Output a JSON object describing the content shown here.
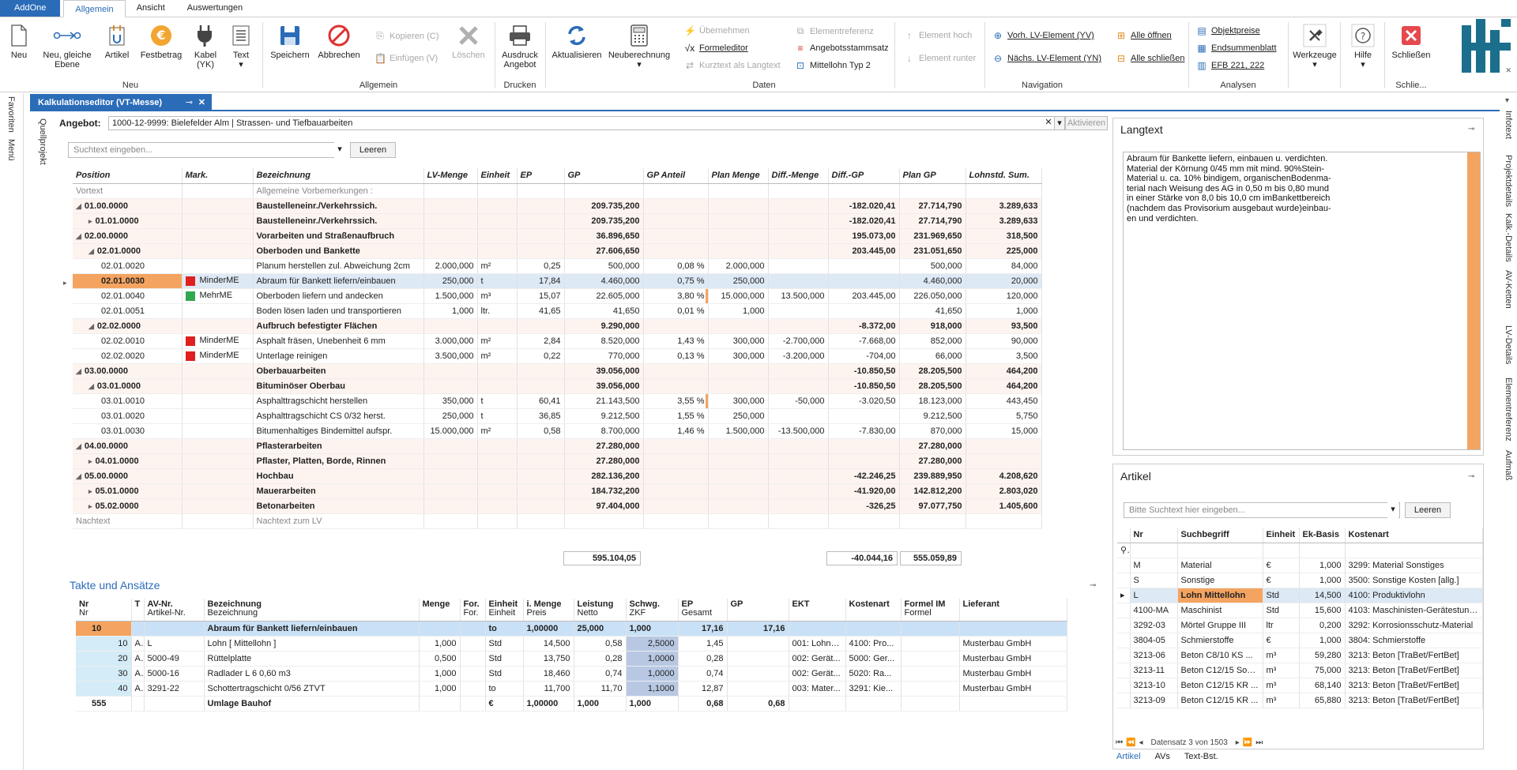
{
  "app_tabs": {
    "addone": "AddOne",
    "items": [
      "Allgemein",
      "Ansicht",
      "Auswertungen"
    ]
  },
  "ribbon": {
    "neu": "Neu",
    "neu_gleiche": "Neu, gleiche",
    "ebene": "Ebene",
    "artikel": "Artikel",
    "festbetrag": "Festbetrag",
    "kabel": "Kabel",
    "yk": "(YK)",
    "text": "Text",
    "neu_group": "Neu",
    "speichern": "Speichern",
    "abbrechen": "Abbrechen",
    "kopieren": "Kopieren (C)",
    "einfuegen": "Einfügen (V)",
    "loeschen": "Löschen",
    "allgemein_group": "Allgemein",
    "ausdruck": "Ausdruck",
    "angebot": "Angebot",
    "drucken_group": "Drucken",
    "aktualisieren": "Aktualisieren",
    "neuberechnung": "Neuberechnung",
    "uebernehmen": "Übernehmen",
    "formeleditor": "Formeleditor",
    "kurztext": "Kurztext als Langtext",
    "elementreferenz": "Elementreferenz",
    "angebotsstammsatz": "Angebotsstammsatz",
    "mittellohn": "Mittellohn Typ 2",
    "daten_group": "Daten",
    "element_hoch": "Element hoch",
    "element_runter": "Element runter",
    "vorh": "Vorh. LV-Element (YV)",
    "naechs": "Nächs. LV-Element (YN)",
    "alle_oeffnen": "Alle öffnen",
    "alle_schliessen": "Alle schließen",
    "navigation_group": "Navigation",
    "objektpreise": "Objektpreise",
    "endsummenblatt": "Endsummenblatt",
    "efb": "EFB 221, 222",
    "analysen_group": "Analysen",
    "werkzeuge": "Werkzeuge",
    "hilfe": "Hilfe",
    "schliessen": "Schließen",
    "schlie_group": "Schlie..."
  },
  "left_rail": [
    "Favoriten",
    "Menü"
  ],
  "right_rail": [
    "Infotext",
    "Projektdetails",
    "Kalk.-Details",
    "AV-Ketten",
    "LV-Details",
    "Elementreferenz",
    "Aufmaß"
  ],
  "doc_tab": "Kalkulationseditor (VT-Messe)",
  "quellprojekt": "Quellprojekt",
  "angebot": {
    "label": "Angebot:",
    "value": "1000-12-9999: Bielefelder Alm | Strassen- und Tiefbauarbeiten",
    "aktivieren": "Aktivieren"
  },
  "search": {
    "placeholder": "Suchtext eingeben...",
    "button": "Leeren"
  },
  "lv": {
    "headers": [
      "Position",
      "Mark.",
      "Bezeichnung",
      "LV-Menge",
      "Einheit",
      "EP",
      "GP",
      "GP Anteil",
      "Plan Menge",
      "Diff.-Menge",
      "Diff.-GP",
      "Plan GP",
      "Lohnstd. Sum."
    ],
    "rows": [
      {
        "ind": 0,
        "pos": "Vortext",
        "mark": "",
        "bez": "Allgemeine Vorbemerkungen :",
        "lvm": "",
        "ein": "",
        "ep": "",
        "gp": "",
        "ant": "",
        "pm": "",
        "dm": "",
        "dgp": "",
        "pgp": "",
        "ls": "",
        "cls": "dim"
      },
      {
        "ind": 0,
        "tri": "◢",
        "pos": "01.00.0000",
        "bez": "Baustelleneinr./Verkehrssich.",
        "gp": "209.735,200",
        "dgp": "-182.020,41",
        "pgp": "27.714,790",
        "ls": "3.289,633",
        "cls": "b lvl1"
      },
      {
        "ind": 1,
        "tri": "▸",
        "pos": "01.01.0000",
        "bez": "Baustelleneinr./Verkehrssich.",
        "gp": "209.735,200",
        "dgp": "-182.020,41",
        "pgp": "27.714,790",
        "ls": "3.289,633",
        "cls": "b lvl1"
      },
      {
        "ind": 0,
        "tri": "◢",
        "pos": "02.00.0000",
        "bez": "Vorarbeiten und Straßenaufbruch",
        "gp": "36.896,650",
        "dgp": "195.073,00",
        "pgp": "231.969,650",
        "ls": "318,500",
        "cls": "b lvl1"
      },
      {
        "ind": 1,
        "tri": "◢",
        "pos": "02.01.0000",
        "bez": "Oberboden und Bankette",
        "gp": "27.606,650",
        "dgp": "203.445,00",
        "pgp": "231.051,650",
        "ls": "225,000",
        "cls": "b lvl1"
      },
      {
        "ind": 2,
        "pos": "02.01.0020",
        "bez": "Planum herstellen zul. Abweichung 2cm",
        "lvm": "2.000,000",
        "ein": "m²",
        "ep": "0,25",
        "gp": "500,000",
        "ant": "0,08 %",
        "pm": "2.000,000",
        "pgp": "500,000",
        "ls": "84,000"
      },
      {
        "ind": 2,
        "pos": "02.01.0030",
        "mark": "red",
        "markt": "MinderME",
        "bez": "Abraum für Bankett liefern/einbauen",
        "lvm": "250,000",
        "ein": "t",
        "ep": "17,84",
        "gp": "4.460,000",
        "ant": "0,75 %",
        "pm": "250,000",
        "pgp": "4.460,000",
        "ls": "20,000",
        "cls": "sel",
        "hl": true
      },
      {
        "ind": 2,
        "pos": "02.01.0040",
        "mark": "green",
        "markt": "MehrME",
        "bez": "Oberboden liefern und andecken",
        "lvm": "1.500,000",
        "ein": "m³",
        "ep": "15,07",
        "gp": "22.605,000",
        "ant": "3,80 %",
        "pm": "15.000,000",
        "dm": "13.500,000",
        "dgp": "203.445,00",
        "pgp": "226.050,000",
        "ls": "120,000",
        "bar": true
      },
      {
        "ind": 2,
        "pos": "02.01.0051",
        "bez": "Boden lösen laden und transportieren",
        "lvm": "1,000",
        "ein": "ltr.",
        "ep": "41,65",
        "gp": "41,650",
        "ant": "0,01 %",
        "pm": "1,000",
        "pgp": "41,650",
        "ls": "1,000"
      },
      {
        "ind": 1,
        "tri": "◢",
        "pos": "02.02.0000",
        "bez": "Aufbruch befestigter Flächen",
        "gp": "9.290,000",
        "dgp": "-8.372,00",
        "pgp": "918,000",
        "ls": "93,500",
        "cls": "b lvl1"
      },
      {
        "ind": 2,
        "pos": "02.02.0010",
        "mark": "red",
        "markt": "MinderME",
        "bez": "Asphalt fräsen,  Unebenheit 6 mm",
        "lvm": "3.000,000",
        "ein": "m²",
        "ep": "2,84",
        "gp": "8.520,000",
        "ant": "1,43 %",
        "pm": "300,000",
        "dm": "-2.700,000",
        "dgp": "-7.668,00",
        "pgp": "852,000",
        "ls": "90,000"
      },
      {
        "ind": 2,
        "pos": "02.02.0020",
        "mark": "red",
        "markt": "MinderME",
        "bez": "Unterlage reinigen",
        "lvm": "3.500,000",
        "ein": "m²",
        "ep": "0,22",
        "gp": "770,000",
        "ant": "0,13 %",
        "pm": "300,000",
        "dm": "-3.200,000",
        "dgp": "-704,00",
        "pgp": "66,000",
        "ls": "3,500"
      },
      {
        "ind": 0,
        "tri": "◢",
        "pos": "03.00.0000",
        "bez": "Oberbauarbeiten",
        "gp": "39.056,000",
        "dgp": "-10.850,50",
        "pgp": "28.205,500",
        "ls": "464,200",
        "cls": "b lvl1"
      },
      {
        "ind": 1,
        "tri": "◢",
        "pos": "03.01.0000",
        "bez": "Bituminöser Oberbau",
        "gp": "39.056,000",
        "dgp": "-10.850,50",
        "pgp": "28.205,500",
        "ls": "464,200",
        "cls": "b lvl1"
      },
      {
        "ind": 2,
        "pos": "03.01.0010",
        "bez": "Asphalttragschicht herstellen",
        "lvm": "350,000",
        "ein": "t",
        "ep": "60,41",
        "gp": "21.143,500",
        "ant": "3,55 %",
        "pm": "300,000",
        "dm": "-50,000",
        "dgp": "-3.020,50",
        "pgp": "18.123,000",
        "ls": "443,450",
        "bar": true
      },
      {
        "ind": 2,
        "pos": "03.01.0020",
        "bez": "Asphalttragschicht CS 0/32 herst.",
        "lvm": "250,000",
        "ein": "t",
        "ep": "36,85",
        "gp": "9.212,500",
        "ant": "1,55 %",
        "pm": "250,000",
        "pgp": "9.212,500",
        "ls": "5,750"
      },
      {
        "ind": 2,
        "pos": "03.01.0030",
        "bez": "Bitumenhaltiges Bindemittel aufspr.",
        "lvm": "15.000,000",
        "ein": "m²",
        "ep": "0,58",
        "gp": "8.700,000",
        "ant": "1,46 %",
        "pm": "1.500,000",
        "dm": "-13.500,000",
        "dgp": "-7.830,00",
        "pgp": "870,000",
        "ls": "15,000"
      },
      {
        "ind": 0,
        "tri": "◢",
        "pos": "04.00.0000",
        "bez": "Pflasterarbeiten",
        "gp": "27.280,000",
        "pgp": "27.280,000",
        "cls": "b lvl1"
      },
      {
        "ind": 1,
        "tri": "▸",
        "pos": "04.01.0000",
        "bez": "Pflaster, Platten, Borde, Rinnen",
        "gp": "27.280,000",
        "pgp": "27.280,000",
        "cls": "b lvl1"
      },
      {
        "ind": 0,
        "tri": "◢",
        "pos": "05.00.0000",
        "bez": "Hochbau",
        "gp": "282.136,200",
        "dgp": "-42.246,25",
        "pgp": "239.889,950",
        "ls": "4.208,620",
        "cls": "b lvl1"
      },
      {
        "ind": 1,
        "tri": "▸",
        "pos": "05.01.0000",
        "bez": "Mauerarbeiten",
        "gp": "184.732,200",
        "dgp": "-41.920,00",
        "pgp": "142.812,200",
        "ls": "2.803,020",
        "cls": "b lvl1"
      },
      {
        "ind": 1,
        "tri": "▸",
        "pos": "05.02.0000",
        "bez": "Betonarbeiten",
        "gp": "97.404,000",
        "dgp": "-326,25",
        "pgp": "97.077,750",
        "ls": "1.405,600",
        "cls": "b lvl1"
      },
      {
        "ind": 0,
        "pos": "Nachtext",
        "bez": "Nachtext zum LV",
        "cls": "dim"
      }
    ],
    "totals": {
      "gp": "595.104,05",
      "dgp": "-40.044,16",
      "pgp": "555.059,89"
    }
  },
  "takte": {
    "title": "Takte und Ansätze",
    "headers1": [
      "Nr",
      "T",
      "AV-Nr.",
      "Bezeichnung",
      "Menge",
      "For.",
      "Einheit",
      "i. Menge",
      "Leistung",
      "Schwg.",
      "EP",
      "GP",
      "EKT",
      "Kostenart",
      "Formel IM",
      "Lieferant"
    ],
    "headers2": [
      "Nr",
      "",
      "Artikel-Nr.",
      "Bezeichnung",
      "",
      "For.",
      "Einheit",
      "Preis",
      "Netto",
      "ZKF",
      "Gesamt",
      "",
      "",
      "",
      "Formel",
      ""
    ],
    "rows": [
      {
        "nr": "10",
        "t": "",
        "av": "",
        "bez": "Abraum für Bankett liefern/einbauen",
        "menge": "",
        "for": "",
        "ein": "to",
        "im": "1,00000",
        "leist": "25,000",
        "schwg": "1,000",
        "ep": "17,16",
        "gp": "17,16",
        "ekt": "",
        "ka": "",
        "fim": "",
        "lief": "",
        "top": true
      },
      {
        "nr": "10",
        "t": "A",
        "av": "L",
        "bez": "Lohn [ Mittellohn ]",
        "menge": "1,000",
        "for": "",
        "ein": "Std",
        "im": "14,500",
        "leist": "0,58",
        "schwg": "2,5000",
        "ep": "1,45",
        "gp": "",
        "ekt": "001: Lohnk...",
        "ka": "4100: Pro...",
        "fim": "",
        "lief": "Musterbau GmbH"
      },
      {
        "nr": "20",
        "t": "A",
        "av": "5000-49",
        "bez": "Rüttelplatte",
        "menge": "0,500",
        "for": "",
        "ein": "Std",
        "im": "13,750",
        "leist": "0,28",
        "schwg": "1,0000",
        "ep": "0,28",
        "gp": "",
        "ekt": "002: Gerät...",
        "ka": "5000: Ger...",
        "fim": "",
        "lief": "Musterbau GmbH",
        "exp": true
      },
      {
        "nr": "30",
        "t": "A",
        "av": "5000-16",
        "bez": "Radlader L 6    0,60 m3",
        "menge": "1,000",
        "for": "",
        "ein": "Std",
        "im": "18,460",
        "leist": "0,74",
        "schwg": "1,0000",
        "ep": "0,74",
        "gp": "",
        "ekt": "002: Gerät...",
        "ka": "5020: Ra...",
        "fim": "",
        "lief": "Musterbau GmbH",
        "exp": true
      },
      {
        "nr": "40",
        "t": "A",
        "av": "3291-22",
        "bez": "Schottertragschicht  0/56 ZTVT",
        "menge": "1,000",
        "for": "",
        "ein": "to",
        "im": "11,700",
        "leist": "11,70",
        "schwg": "1,1000",
        "ep": "12,87",
        "gp": "",
        "ekt": "003: Mater...",
        "ka": "3291: Kie...",
        "fim": "",
        "lief": "Musterbau GmbH"
      },
      {
        "nr": "555",
        "t": "",
        "av": "",
        "bez": "Umlage Bauhof",
        "menge": "",
        "for": "",
        "ein": "€",
        "im": "1,00000",
        "leist": "1,000",
        "schwg": "1,000",
        "ep": "0,68",
        "gp": "0,68",
        "ekt": "",
        "ka": "",
        "fim": "",
        "lief": "",
        "bold": true
      }
    ]
  },
  "langtext": {
    "title": "Langtext",
    "lines": [
      "Abraum für Bankette liefern, einbauen u. verdichten.",
      "Material der Körnung 0/45 mm mit mind. 90%Stein-",
      "Material u. ca. 10% bindigem, organischenBodenma-",
      "terial  nach Weisung des AG in 0,50 m bis 0,80 mund",
      "in einer Stärke von 8,0 bis 10,0 cm imBankettbereich",
      "(nachdem das Provisorium ausgebaut wurde)einbau-",
      "en und verdichten."
    ]
  },
  "artikel": {
    "title": "Artikel",
    "placeholder": "Bitte Suchtext hier eingeben...",
    "button": "Leeren",
    "headers": [
      "Nr",
      "Suchbegriff",
      "Einheit",
      "Ek-Basis",
      "Kostenart"
    ],
    "rows": [
      [
        "M",
        "Material",
        "€",
        "1,000",
        "3299: Material Sonstiges"
      ],
      [
        "S",
        "Sonstige",
        "€",
        "1,000",
        "3500: Sonstige Kosten [allg.]"
      ],
      [
        "L",
        "Lohn Mittellohn",
        "Std",
        "14,500",
        "4100: Produktivlohn"
      ],
      [
        "4100-MA",
        "Maschinist",
        "Std",
        "15,600",
        "4103: Maschinisten-Gerätestunde"
      ],
      [
        "3292-03",
        "Mörtel Gruppe III",
        "ltr",
        "0,200",
        "3292: Korrosionsschutz-Material"
      ],
      [
        "3804-05",
        "Schmierstoffe",
        "€",
        "1,000",
        "3804: Schmierstoffe"
      ],
      [
        "3213-06",
        "Beton C8/10  KS ...",
        "m³",
        "59,280",
        "3213: Beton [TraBet/FertBet]"
      ],
      [
        "3213-11",
        "Beton C12/15 Son...",
        "m³",
        "75,000",
        "3213: Beton [TraBet/FertBet]"
      ],
      [
        "3213-10",
        "Beton C12/15  KR ...",
        "m³",
        "68,140",
        "3213: Beton [TraBet/FertBet]"
      ],
      [
        "3213-09",
        "Beton C12/15  KR ...",
        "m³",
        "65,880",
        "3213: Beton [TraBet/FertBet]"
      ]
    ],
    "nav": "Datensatz 3 von 1503",
    "tabs": [
      "Artikel",
      "AVs",
      "Text-Bst."
    ]
  }
}
